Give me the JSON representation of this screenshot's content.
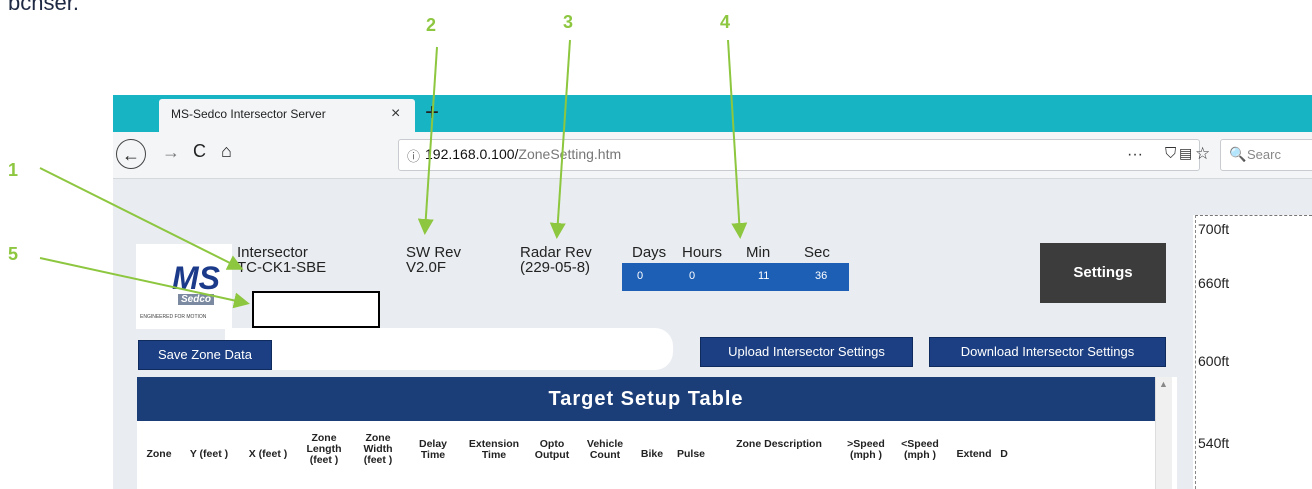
{
  "header_fragment": "bcnser.",
  "callouts": [
    "1",
    "2",
    "3",
    "4",
    "5"
  ],
  "browser": {
    "tab_title": "MS-Sedco Intersector Server",
    "tab_close": "×",
    "new_tab": "+",
    "url_info_icon": "ⓘ",
    "url_host": "192.168.0.100/",
    "url_path": "ZoneSetting.htm",
    "search_placeholder": "Searc",
    "icons": {
      "back": "←",
      "forward": "→",
      "reload": "C",
      "home": "⌂",
      "reader": "▤",
      "more": "···",
      "pocket": "⛉",
      "star": "☆",
      "search": "🔍"
    },
    "theme_color": "#17b5c4"
  },
  "page": {
    "logo": {
      "text": "MS",
      "sub": "Sedco",
      "tagline": "ENGINEERED FOR MOTION"
    },
    "intersector": {
      "label": "Intersector",
      "value": "TC-CK1-SBE"
    },
    "sw_rev": {
      "label": "SW Rev",
      "value": "V2.0F"
    },
    "radar_rev": {
      "label": "Radar Rev",
      "value": "(229-05-8)"
    },
    "uptime": {
      "labels": [
        "Days",
        "Hours",
        "Min",
        "Sec"
      ],
      "values": [
        "0",
        "0",
        "11",
        "36"
      ]
    },
    "settings_button": "Settings",
    "save_zone_button": "Save Zone Data",
    "upload_button": "Upload Intersector Settings",
    "download_button": "Download Intersector Settings",
    "table": {
      "title": "Target Setup Table",
      "columns": [
        "Zone",
        "Y (feet )",
        "X (feet )",
        "Zone Length (feet )",
        "Zone Width (feet )",
        "Delay Time",
        "Extension Time",
        "Opto Output",
        "Vehicle Count",
        "Bike",
        "Pulse",
        "Zone Description",
        ">Speed (mph )",
        "<Speed (mph )",
        "Extend",
        "D"
      ]
    },
    "scale_labels": [
      "700ft",
      "660ft",
      "600ft",
      "540ft"
    ]
  },
  "colors": {
    "callout": "#8dc63f",
    "table_header": "#1b3d78",
    "status_box": "#1d5fb5",
    "button_blue": "#1b3f82",
    "settings_bg": "#3c3c3c"
  }
}
